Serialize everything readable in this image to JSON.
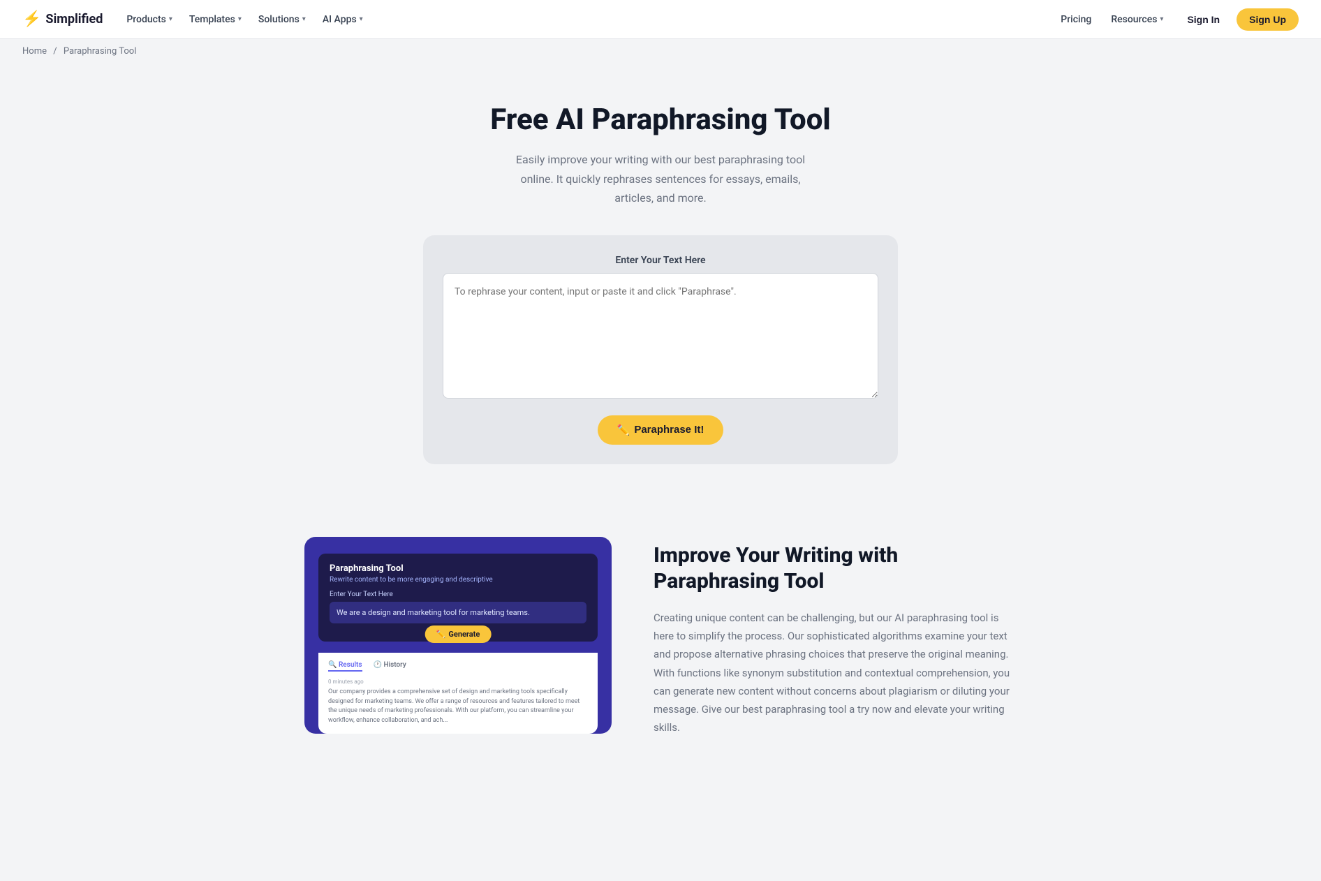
{
  "brand": {
    "name": "Simplified",
    "logo_icon": "⚡"
  },
  "nav": {
    "products_label": "Products",
    "templates_label": "Templates",
    "solutions_label": "Solutions",
    "ai_apps_label": "AI Apps",
    "pricing_label": "Pricing",
    "resources_label": "Resources",
    "signin_label": "Sign In",
    "signup_label": "Sign Up"
  },
  "breadcrumb": {
    "home_label": "Home",
    "separator": "/",
    "current_label": "Paraphrasing Tool"
  },
  "hero": {
    "title": "Free AI Paraphrasing Tool",
    "subtitle": "Easily improve your writing with our best paraphrasing tool online. It quickly rephrases sentences for essays, emails, articles, and more."
  },
  "tool": {
    "label": "Enter Your Text Here",
    "textarea_placeholder": "To rephrase your content, input or paste it and click \"Paraphrase\".",
    "button_icon": "✏️",
    "button_label": "Paraphrase It!"
  },
  "features": {
    "title": "Improve Your Writing with Paraphrasing Tool",
    "description": "Creating unique content can be challenging, but our AI paraphrasing tool is here to simplify the process. Our sophisticated algorithms examine your text and propose alternative phrasing choices that preserve the original meaning. With functions like synonym substitution and contextual comprehension, you can generate new content without concerns about plagiarism or diluting your message. Give our best paraphrasing tool a try now and elevate your writing skills.",
    "mock": {
      "tool_title": "Paraphrasing Tool",
      "tool_sub": "Rewrite content to be more engaging and descriptive",
      "input_label": "Enter Your Text Here",
      "input_text": "We are a design and marketing tool for marketing teams.",
      "generate_label": "Generate",
      "generate_icon": "✏️",
      "tab_results": "Results",
      "tab_history": "History",
      "result_time": "0 minutes ago",
      "result_text": "Our company provides a comprehensive set of design and marketing tools specifically designed for marketing teams. We offer a range of resources and features tailored to meet the unique needs of marketing professionals. With our platform, you can streamline your workflow, enhance collaboration, and ach..."
    }
  }
}
